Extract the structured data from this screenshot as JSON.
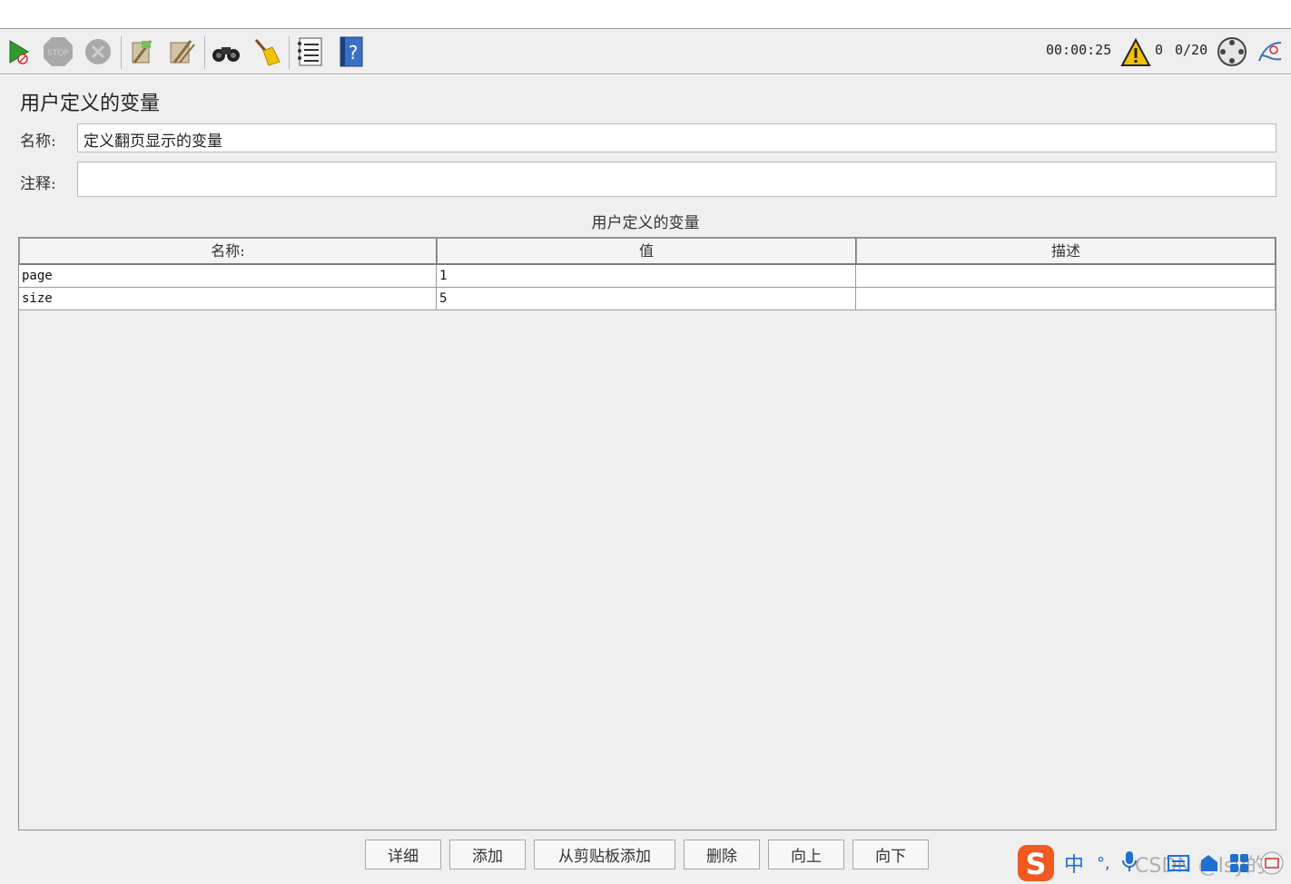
{
  "toolbar": {
    "elapsed_time": "00:00:25",
    "warning_count": "0",
    "threads": "0/20"
  },
  "panel": {
    "title": "用户定义的变量",
    "name_label": "名称:",
    "name_value": "定义翻页显示的变量",
    "comment_label": "注释:",
    "comment_value": ""
  },
  "table": {
    "caption": "用户定义的变量",
    "columns": [
      "名称:",
      "值",
      "描述"
    ],
    "rows": [
      {
        "name": "page",
        "value": "1",
        "desc": ""
      },
      {
        "name": "size",
        "value": "5",
        "desc": ""
      }
    ]
  },
  "buttons": {
    "detail": "详细",
    "add": "添加",
    "add_from_clipboard": "从剪贴板添加",
    "delete": "删除",
    "up": "向上",
    "down": "向下"
  },
  "ime": {
    "mode": "中",
    "punct": "°,",
    "watermark": "CSDN @lsy的"
  },
  "colors": {
    "run_green": "#2e9b2e",
    "warning_yellow": "#f2c200",
    "help_blue": "#3a6fc4",
    "ime_orange": "#f05a22"
  }
}
